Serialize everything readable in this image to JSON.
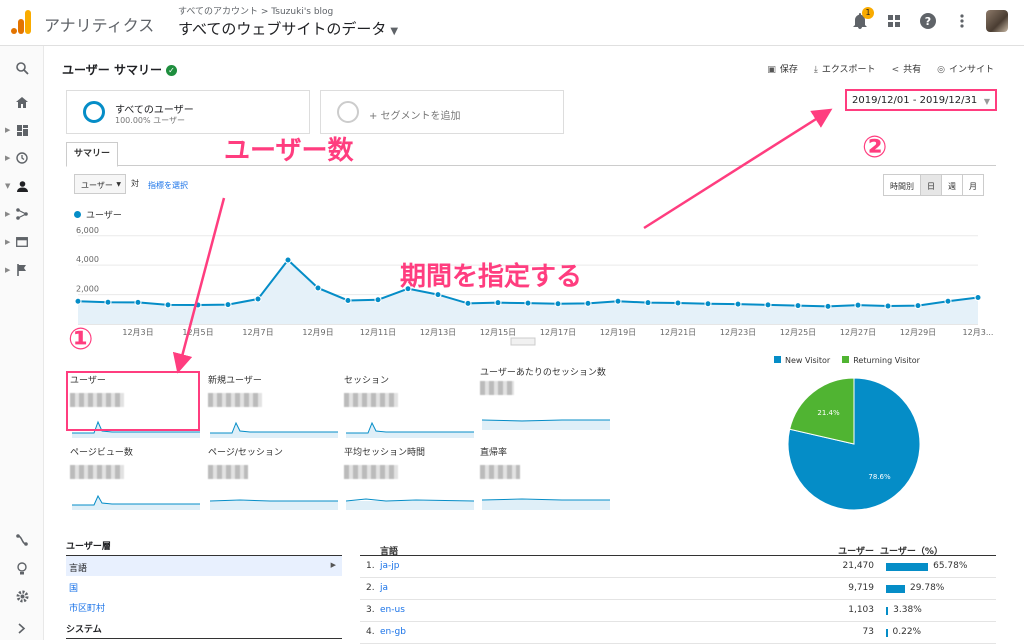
{
  "header": {
    "app_title": "アナリティクス",
    "breadcrumb": "すべてのアカウント > Tsuzuki's blog",
    "view_title": "すべてのウェブサイトのデータ",
    "notification_count": "1"
  },
  "page": {
    "title": "ユーザー サマリー",
    "actions": {
      "save": "保存",
      "export": "エクスポート",
      "share": "共有",
      "insights": "インサイト"
    }
  },
  "segments": {
    "active_name": "すべてのユーザー",
    "active_sub": "100.00% ユーザー",
    "add_label": "+ セグメントを追加"
  },
  "date_range": "2019/12/01 - 2019/12/31",
  "tabs": {
    "summary": "サマリー"
  },
  "controls": {
    "metric": "ユーザー",
    "vs": "対",
    "select_metric": "指標を選択",
    "granularity": [
      "時間別",
      "日",
      "週",
      "月"
    ]
  },
  "annotations": {
    "users_count": "ユーザー数",
    "set_period": "期間を指定する",
    "step1": "①",
    "step2": "②"
  },
  "chart_data": [
    {
      "type": "line",
      "series": [
        {
          "name": "ユーザー",
          "values": [
            1550,
            1480,
            1470,
            1300,
            1290,
            1320,
            1700,
            4350,
            2450,
            1600,
            1650,
            2400,
            2000,
            1400,
            1450,
            1420,
            1380,
            1400,
            1550,
            1450,
            1430,
            1380,
            1350,
            1300,
            1250,
            1200,
            1280,
            1220,
            1250,
            1550,
            1800
          ]
        }
      ],
      "x_tick_labels": [
        "12月3日",
        "12月5日",
        "12月7日",
        "12月9日",
        "12月11日",
        "12月13日",
        "12月15日",
        "12月17日",
        "12月19日",
        "12月21日",
        "12月23日",
        "12月25日",
        "12月27日",
        "12月29日",
        "12月3..."
      ],
      "y_tick_labels": [
        "2,000",
        "4,000",
        "6,000"
      ],
      "ylim": [
        0,
        6800
      ],
      "grid": true
    },
    {
      "type": "pie",
      "series": [
        {
          "name": "New Visitor",
          "value": 78.6,
          "color": "#058dc7"
        },
        {
          "name": "Returning Visitor",
          "value": 21.4,
          "color": "#50b432"
        }
      ],
      "slice_labels": [
        "78.6%",
        "21.4%"
      ],
      "legend": "top"
    }
  ],
  "kpis": [
    {
      "label": "ユーザー"
    },
    {
      "label": "新規ユーザー"
    },
    {
      "label": "セッション"
    },
    {
      "label": "ユーザーあたりのセッション数"
    },
    {
      "label": "ページビュー数"
    },
    {
      "label": "ページ/セッション"
    },
    {
      "label": "平均セッション時間"
    },
    {
      "label": "直帰率"
    }
  ],
  "dimensions": {
    "heading": "ユーザー層",
    "items": [
      "言語",
      "国",
      "市区町村"
    ],
    "heading2": "システム"
  },
  "lang_table": {
    "headers": {
      "lang": "言語",
      "users": "ユーザー",
      "pct": "ユーザー（%）"
    },
    "rows": [
      {
        "idx": "1.",
        "lang": "ja-jp",
        "users": "21,470",
        "pct": "65.78%",
        "share": 65.78
      },
      {
        "idx": "2.",
        "lang": "ja",
        "users": "9,719",
        "pct": "29.78%",
        "share": 29.78
      },
      {
        "idx": "3.",
        "lang": "en-us",
        "users": "1,103",
        "pct": "3.38%",
        "share": 3.38
      },
      {
        "idx": "4.",
        "lang": "en-gb",
        "users": "73",
        "pct": "0.22%",
        "share": 0.22
      }
    ]
  },
  "colors": {
    "accent": "#058dc7",
    "annotation": "#ff3d7f",
    "returning": "#50b432"
  }
}
